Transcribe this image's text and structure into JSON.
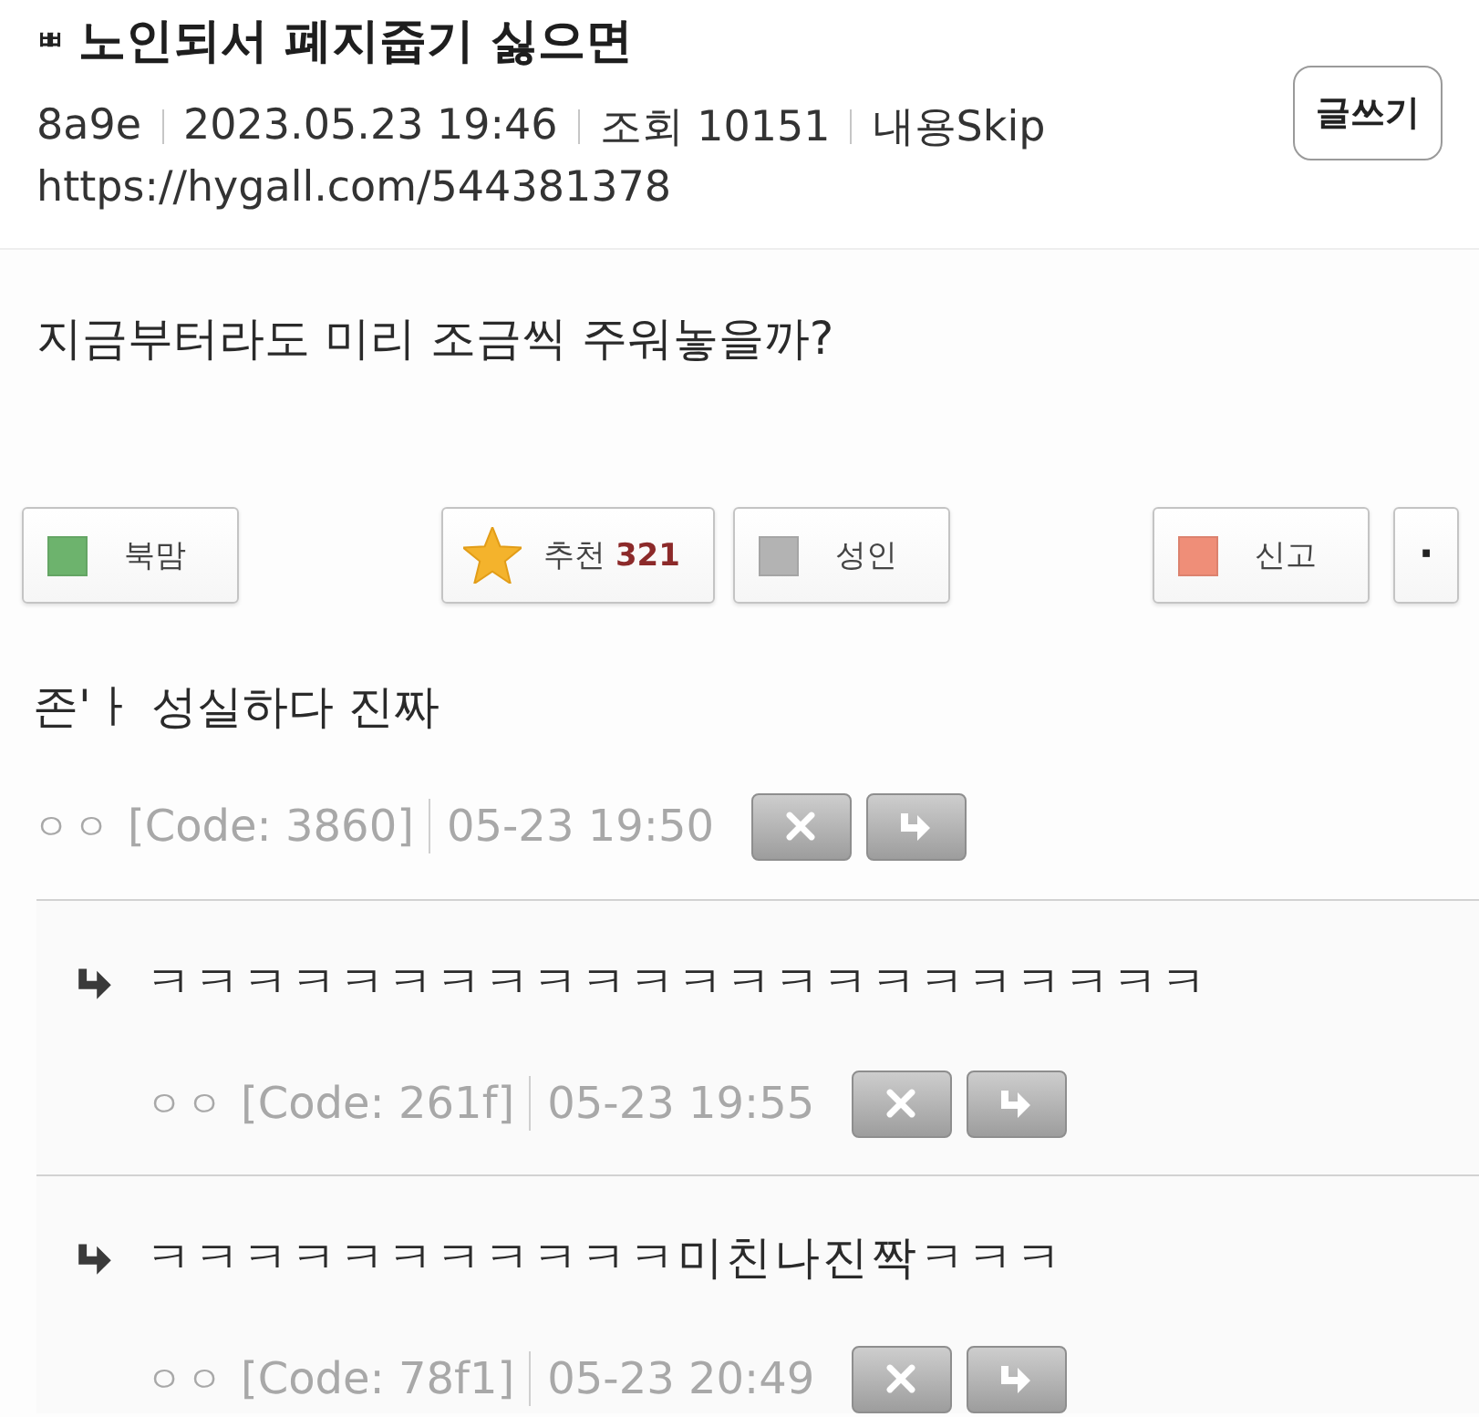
{
  "post": {
    "board_mark": "ㅃ",
    "title": "노인되서 폐지줍기 싫으면",
    "meta": {
      "author": "8a9e",
      "date": "2023.05.23 19:46",
      "views": "조회 10151",
      "flag": "내용Skip"
    },
    "url": "https://hygall.com/544381378",
    "body": "지금부터라도 미리 조금씩 주워놓을까?"
  },
  "write_button": "글쓰기",
  "actions": {
    "left": [
      {
        "kind": "swatch",
        "label": "북맘",
        "color": "#6db36d"
      }
    ],
    "center": [
      {
        "kind": "star",
        "label": "추천",
        "count": "321"
      },
      {
        "kind": "swatch",
        "label": "성인",
        "color": "#b3b3b3"
      }
    ],
    "right": [
      {
        "kind": "swatch",
        "label": "신고",
        "color": "#ef8e78"
      },
      {
        "kind": "more",
        "label": "·"
      }
    ]
  },
  "comments": [
    {
      "text": "존'ㅏ 성실하다 진짜",
      "author": "ㅇㅇ",
      "code": "[Code: 3860]",
      "time": "05-23 19:50",
      "children": [
        {
          "text": "ㅋㅋㅋㅋㅋㅋㅋㅋㅋㅋㅋㅋㅋㅋㅋㅋㅋㅋㅋㅋㅋㅋ",
          "author": "ㅇㅇ",
          "code": "[Code: 261f]",
          "time": "05-23 19:55"
        },
        {
          "text": "ㅋㅋㅋㅋㅋㅋㅋㅋㅋㅋㅋ미친나진짝ㅋㅋㅋ",
          "author": "ㅇㅇ",
          "code": "[Code: 78f1]",
          "time": "05-23 20:49"
        }
      ]
    }
  ]
}
